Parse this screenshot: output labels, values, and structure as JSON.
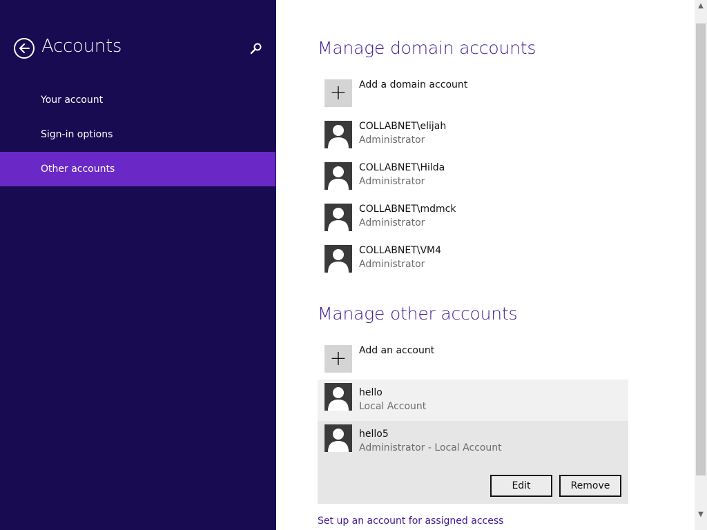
{
  "sidebar": {
    "title": "Accounts",
    "back_icon": "back-arrow-icon",
    "search_icon": "search-icon",
    "items": [
      {
        "label": "Your account"
      },
      {
        "label": "Sign-in options"
      },
      {
        "label": "Other accounts",
        "selected": true
      }
    ]
  },
  "domain": {
    "title": "Manage domain accounts",
    "add_label": "Add a domain account",
    "accounts": [
      {
        "name": "COLLABNET\\elijah",
        "role": "Administrator"
      },
      {
        "name": "COLLABNET\\Hilda",
        "role": "Administrator"
      },
      {
        "name": "COLLABNET\\mdmck",
        "role": "Administrator"
      },
      {
        "name": "COLLABNET\\VM4",
        "role": "Administrator"
      }
    ]
  },
  "other": {
    "title": "Manage other accounts",
    "add_label": "Add an account",
    "accounts": [
      {
        "name": "hello",
        "role": "Local Account"
      },
      {
        "name": "hello5",
        "role": "Administrator - Local Account",
        "selected": true
      }
    ],
    "edit_label": "Edit",
    "remove_label": "Remove"
  },
  "assigned_access_link": "Set up an account for assigned access",
  "colors": {
    "sidebar_bg": "#180b52",
    "accent": "#6a28c7",
    "title": "#3d1a91"
  }
}
